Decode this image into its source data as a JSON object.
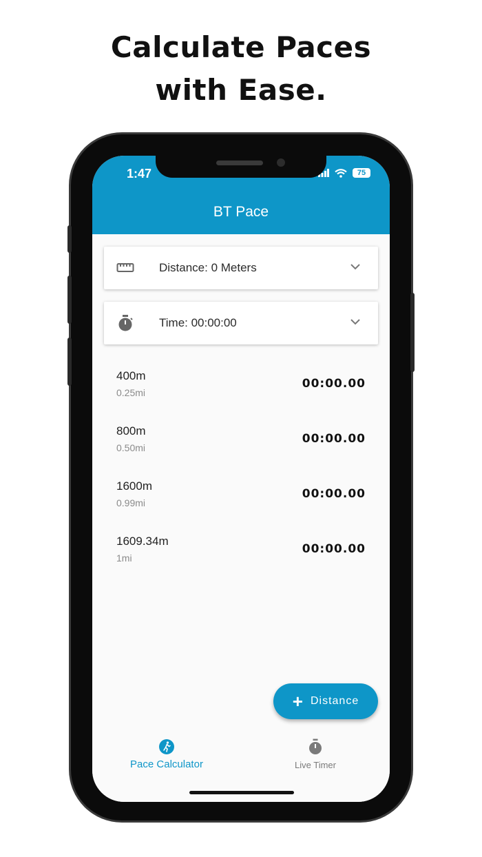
{
  "headline": {
    "line1": "Calculate Paces",
    "line2": "with Ease."
  },
  "status_bar": {
    "time": "1:47",
    "battery": "75"
  },
  "app_bar": {
    "title": "BT Pace"
  },
  "inputs": {
    "distance": {
      "label": "Distance: 0 Meters",
      "icon": "ruler-icon"
    },
    "time": {
      "label": "Time: 00:00:00",
      "icon": "stopwatch-icon"
    }
  },
  "pace_rows": [
    {
      "distance": "400m",
      "miles": "0.25mi",
      "pace": "00:00.00"
    },
    {
      "distance": "800m",
      "miles": "0.50mi",
      "pace": "00:00.00"
    },
    {
      "distance": "1600m",
      "miles": "0.99mi",
      "pace": "00:00.00"
    },
    {
      "distance": "1609.34m",
      "miles": "1mi",
      "pace": "00:00.00"
    }
  ],
  "fab": {
    "label": "Distance"
  },
  "bottom_nav": {
    "items": [
      {
        "label": "Pace Calculator",
        "icon": "runner-icon",
        "active": true
      },
      {
        "label": "Live Timer",
        "icon": "stopwatch-icon",
        "active": false
      }
    ]
  },
  "colors": {
    "accent": "#0e96c8",
    "background": "#fafafa",
    "inactive": "#7a7a7a"
  }
}
